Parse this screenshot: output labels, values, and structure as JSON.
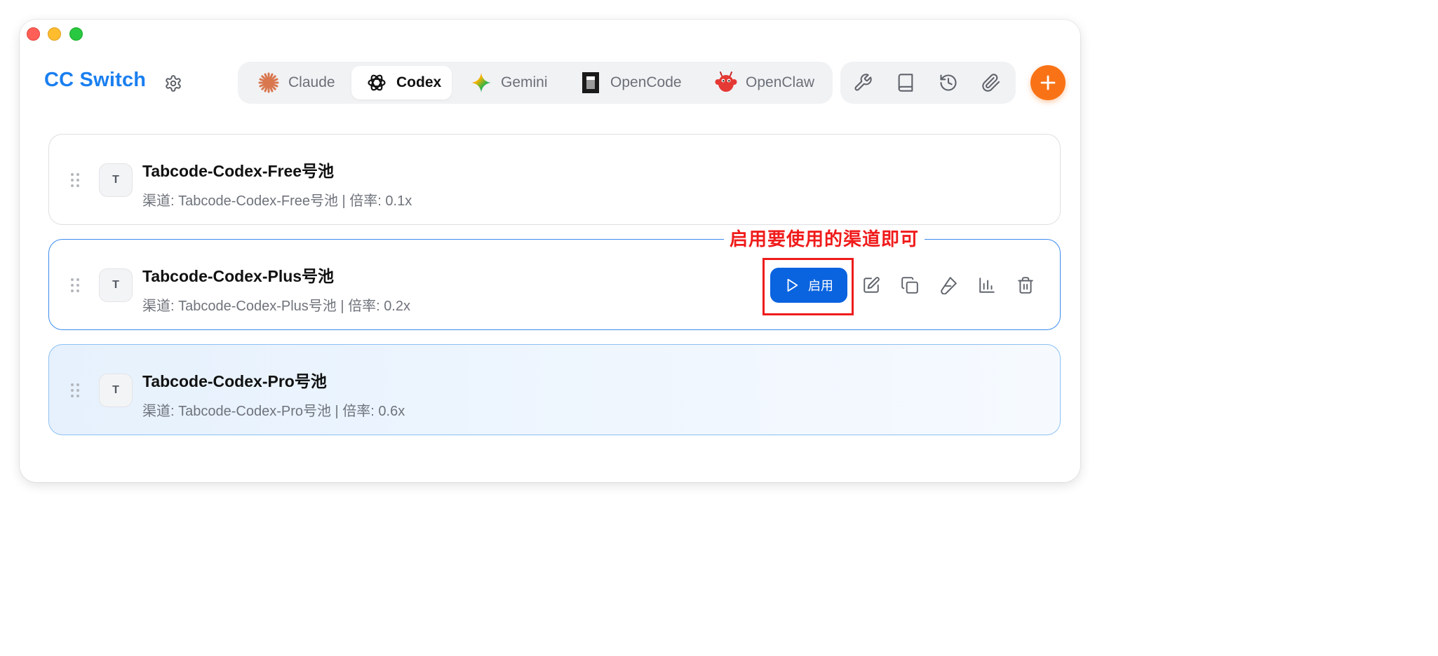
{
  "app": {
    "title": "CC Switch"
  },
  "tabs": [
    {
      "label": "Claude",
      "icon": "claude-icon",
      "active": false
    },
    {
      "label": "Codex",
      "icon": "codex-icon",
      "active": true
    },
    {
      "label": "Gemini",
      "icon": "gemini-icon",
      "active": false
    },
    {
      "label": "OpenCode",
      "icon": "opencode-icon",
      "active": false
    },
    {
      "label": "OpenClaw",
      "icon": "openclaw-icon",
      "active": false
    }
  ],
  "toolbar": {
    "tools": [
      "wrench-icon",
      "book-icon",
      "history-icon",
      "paperclip-icon"
    ],
    "add_label": "+"
  },
  "providers": [
    {
      "avatar": "T",
      "name": "Tabcode-Codex-Free号池",
      "detail": "渠道: Tabcode-Codex-Free号池 | 倍率: 0.1x",
      "state": "normal"
    },
    {
      "avatar": "T",
      "name": "Tabcode-Codex-Plus号池",
      "detail": "渠道: Tabcode-Codex-Plus号池 | 倍率: 0.2x",
      "state": "hover"
    },
    {
      "avatar": "T",
      "name": "Tabcode-Codex-Pro号池",
      "detail": "渠道: Tabcode-Codex-Pro号池 | 倍率: 0.6x",
      "state": "active"
    }
  ],
  "actions": {
    "enable_label": "启用",
    "icons": [
      "edit-icon",
      "duplicate-icon",
      "test-icon",
      "usage-chart-icon",
      "delete-icon"
    ]
  },
  "annotation": {
    "text": "启用要使用的渠道即可",
    "color": "#ee1c1c"
  },
  "colors": {
    "brand": "#1a7ff0",
    "primary_button": "#0a63df",
    "add_button": "#f97316"
  }
}
